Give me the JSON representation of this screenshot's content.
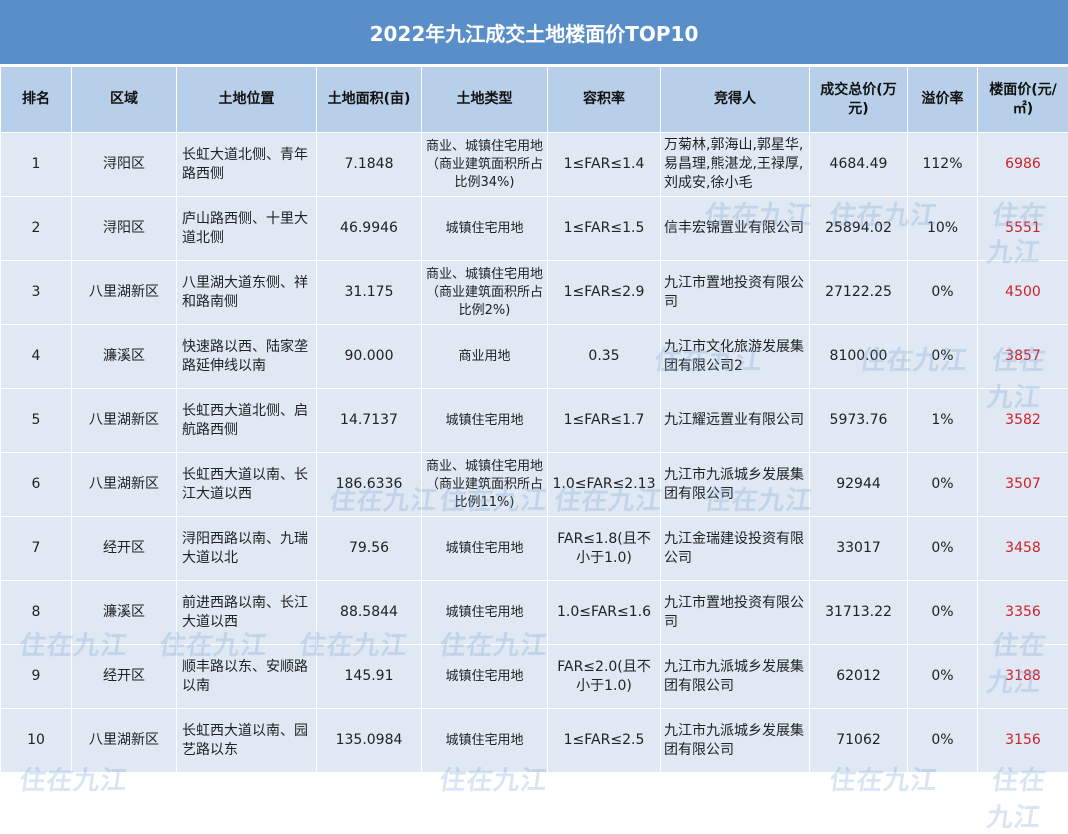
{
  "title": "2022年九江成交土地楼面价TOP10",
  "watermark": "住在九江",
  "headers": {
    "rank": "排名",
    "district": "区域",
    "location": "土地位置",
    "area": "土地面积(亩)",
    "land_type": "土地类型",
    "far": "容积率",
    "winner": "竞得人",
    "total": "成交总价(万元)",
    "premium": "溢价率",
    "floor_price": "楼面价(元/㎡)"
  },
  "rows": [
    {
      "rank": "1",
      "district": "浔阳区",
      "location": "长虹大道北侧、青年路西侧",
      "area": "7.1848",
      "land_type": "商业、城镇住宅用地（商业建筑面积所占比例34%)",
      "far": "1≤FAR≤1.4",
      "winner": "万菊林,郭海山,郭星华,易昌理,熊湛龙,王禄厚,刘成安,徐小毛",
      "total": "4684.49",
      "premium": "112%",
      "floor_price": "6986"
    },
    {
      "rank": "2",
      "district": "浔阳区",
      "location": "庐山路西侧、十里大道北侧",
      "area": "46.9946",
      "land_type": "城镇住宅用地",
      "far": "1≤FAR≤1.5",
      "winner": "信丰宏锦置业有限公司",
      "total": "25894.02",
      "premium": "10%",
      "floor_price": "5551"
    },
    {
      "rank": "3",
      "district": "八里湖新区",
      "location": "八里湖大道东侧、祥和路南侧",
      "area": "31.175",
      "land_type": "商业、城镇住宅用地（商业建筑面积所占比例2%)",
      "far": "1≤FAR≤2.9",
      "winner": "九江市置地投资有限公司",
      "total": "27122.25",
      "premium": "0%",
      "floor_price": "4500"
    },
    {
      "rank": "4",
      "district": "濂溪区",
      "location": "快速路以西、陆家垄路延伸线以南",
      "area": "90.000",
      "land_type": "商业用地",
      "far": "0.35",
      "winner": "九江市文化旅游发展集团有限公司2",
      "total": "8100.00",
      "premium": "0%",
      "floor_price": "3857"
    },
    {
      "rank": "5",
      "district": "八里湖新区",
      "location": "长虹西大道北侧、启航路西侧",
      "area": "14.7137",
      "land_type": "城镇住宅用地",
      "far": "1≤FAR≤1.7",
      "winner": "九江耀远置业有限公司",
      "total": "5973.76",
      "premium": "1%",
      "floor_price": "3582"
    },
    {
      "rank": "6",
      "district": "八里湖新区",
      "location": "长虹西大道以南、长江大道以西",
      "area": "186.6336",
      "land_type": "商业、城镇住宅用地（商业建筑面积所占比例11%)",
      "far": "1.0≤FAR≤2.13",
      "winner": "九江市九派城乡发展集团有限公司",
      "total": "92944",
      "premium": "0%",
      "floor_price": "3507"
    },
    {
      "rank": "7",
      "district": "经开区",
      "location": "浔阳西路以南、九瑞大道以北",
      "area": "79.56",
      "land_type": "城镇住宅用地",
      "far": "FAR≤1.8(且不小于1.0)",
      "winner": "九江金瑞建设投资有限公司",
      "total": "33017",
      "premium": "0%",
      "floor_price": "3458"
    },
    {
      "rank": "8",
      "district": "濂溪区",
      "location": "前进西路以南、长江大道以西",
      "area": "88.5844",
      "land_type": "城镇住宅用地",
      "far": "1.0≤FAR≤1.6",
      "winner": "九江市置地投资有限公司",
      "total": "31713.22",
      "premium": "0%",
      "floor_price": "3356"
    },
    {
      "rank": "9",
      "district": "经开区",
      "location": "顺丰路以东、安顺路以南",
      "area": "145.91",
      "land_type": "城镇住宅用地",
      "far": "FAR≤2.0(且不小于1.0)",
      "winner": "九江市九派城乡发展集团有限公司",
      "total": "62012",
      "premium": "0%",
      "floor_price": "3188"
    },
    {
      "rank": "10",
      "district": "八里湖新区",
      "location": "长虹西大道以南、园艺路以东",
      "area": "135.0984",
      "land_type": "城镇住宅用地",
      "far": "1≤FAR≤2.5",
      "winner": "九江市九派城乡发展集团有限公司",
      "total": "71062",
      "premium": "0%",
      "floor_price": "3156"
    }
  ]
}
